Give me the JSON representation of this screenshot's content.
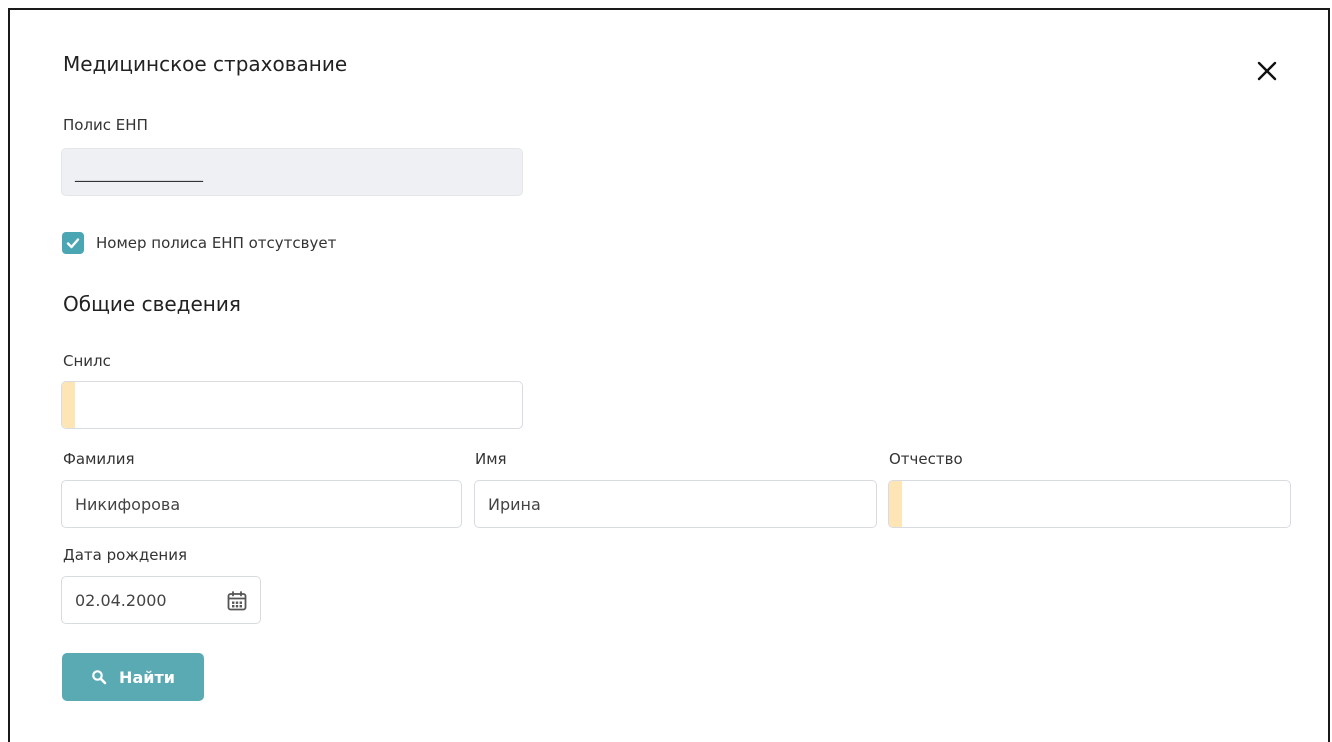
{
  "modal": {
    "title": "Медицинское страхование",
    "close_icon": "close-icon"
  },
  "policy": {
    "label": "Полис ЕНП",
    "value": "________________",
    "disabled": true
  },
  "no_policy_checkbox": {
    "label": "Номер полиса ЕНП отсутсвует",
    "checked": true,
    "color": "#4aa6b3"
  },
  "general": {
    "section_title": "Общие сведения",
    "snils": {
      "label": "Снилс",
      "value": ""
    },
    "surname": {
      "label": "Фамилия",
      "value": "Никифорова"
    },
    "name": {
      "label": "Имя",
      "value": "Ирина"
    },
    "patronymic": {
      "label": "Отчество",
      "value": ""
    },
    "birth_date": {
      "label": "Дата рождения",
      "value": "02.04.2000",
      "icon": "calendar-icon"
    }
  },
  "find_button": {
    "label": "Найти",
    "icon": "search-icon",
    "color": "#5aaab4"
  },
  "colors": {
    "required_marker": "#fde5b6",
    "accent": "#4aa6b3"
  }
}
